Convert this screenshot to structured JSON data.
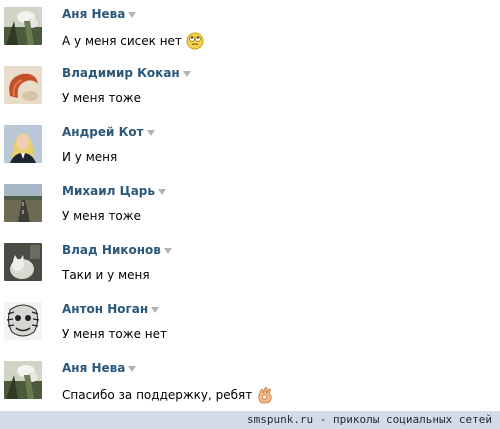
{
  "messages": [
    {
      "author": "Аня Нева",
      "text": "А у меня сисек нет",
      "avatar_icon": "flower-photo-avatar",
      "emoji_icon": "rolling-eyes-icon"
    },
    {
      "author": "Владимир Кокан",
      "text": "У меня тоже",
      "avatar_icon": "sausage-photo-avatar"
    },
    {
      "author": "Андрей Кот",
      "text": "И у меня",
      "avatar_icon": "woman-portrait-avatar"
    },
    {
      "author": "Михаил Царь",
      "text": "У меня тоже",
      "avatar_icon": "road-landscape-avatar"
    },
    {
      "author": "Влад Никонов",
      "text": "Таки и у меня",
      "avatar_icon": "cat-photo-avatar"
    },
    {
      "author": "Антон Ноган",
      "text": "У меня тоже нет",
      "avatar_icon": "drawing-face-avatar"
    },
    {
      "author": "Аня Нева",
      "text": "Спасибо за поддержку, ребят",
      "avatar_icon": "flower-photo-avatar",
      "emoji_icon": "ok-hand-icon"
    }
  ],
  "footer": {
    "text": "smspunk.ru - приколы социальных сетей"
  },
  "colors": {
    "author": "#2b587a",
    "caret": "#b3b3b3",
    "footer_bg": "#d3dbe6"
  }
}
